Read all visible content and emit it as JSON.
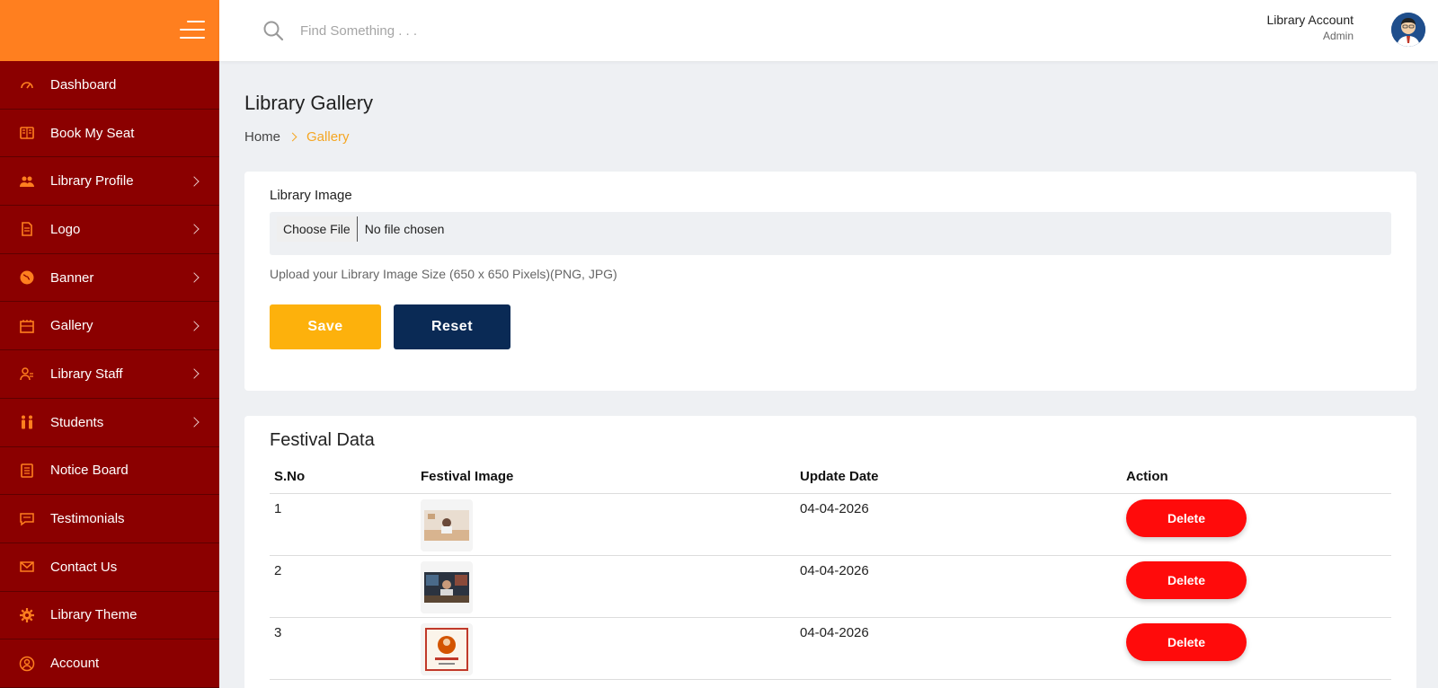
{
  "colors": {
    "sidebar_bg": "#8b0000",
    "brand_bg": "#ff7f1f",
    "accent": "#f5a623",
    "save": "#fdb10c",
    "reset": "#0a2a55",
    "delete": "#ff0b0b"
  },
  "sidebar": {
    "items": [
      {
        "label": "Dashboard",
        "icon": "speedometer-icon",
        "has_submenu": false
      },
      {
        "label": "Book My Seat",
        "icon": "book-icon",
        "has_submenu": false
      },
      {
        "label": "Library Profile",
        "icon": "users-icon",
        "has_submenu": true
      },
      {
        "label": "Logo",
        "icon": "document-icon",
        "has_submenu": true
      },
      {
        "label": "Banner",
        "icon": "globe-icon",
        "has_submenu": true
      },
      {
        "label": "Gallery",
        "icon": "gallery-icon",
        "has_submenu": true
      },
      {
        "label": "Library Staff",
        "icon": "staff-icon",
        "has_submenu": true
      },
      {
        "label": "Students",
        "icon": "students-icon",
        "has_submenu": true
      },
      {
        "label": "Notice Board",
        "icon": "notice-board-icon",
        "has_submenu": false
      },
      {
        "label": "Testimonials",
        "icon": "chat-icon",
        "has_submenu": false
      },
      {
        "label": "Contact Us",
        "icon": "mail-icon",
        "has_submenu": false
      },
      {
        "label": "Library Theme",
        "icon": "gear-icon",
        "has_submenu": false
      },
      {
        "label": "Account",
        "icon": "user-circle-icon",
        "has_submenu": false
      }
    ]
  },
  "header": {
    "search_placeholder": "Find Something . . .",
    "account_name": "Library Account",
    "account_role": "Admin"
  },
  "page": {
    "title": "Library Gallery",
    "breadcrumb": {
      "home": "Home",
      "current": "Gallery"
    }
  },
  "upload": {
    "label": "Library Image",
    "choose_file": "Choose File",
    "file_status": "No file chosen",
    "hint": "Upload your Library Image Size (650 x 650 Pixels)(PNG, JPG)",
    "save_label": "Save",
    "reset_label": "Reset"
  },
  "festival": {
    "title": "Festival Data",
    "columns": {
      "sno": "S.No",
      "image": "Festival Image",
      "date": "Update Date",
      "action": "Action"
    },
    "rows": [
      {
        "sno": "1",
        "date": "04-04-2026",
        "action": "Delete"
      },
      {
        "sno": "2",
        "date": "04-04-2026",
        "action": "Delete"
      },
      {
        "sno": "3",
        "date": "04-04-2026",
        "action": "Delete"
      }
    ]
  }
}
